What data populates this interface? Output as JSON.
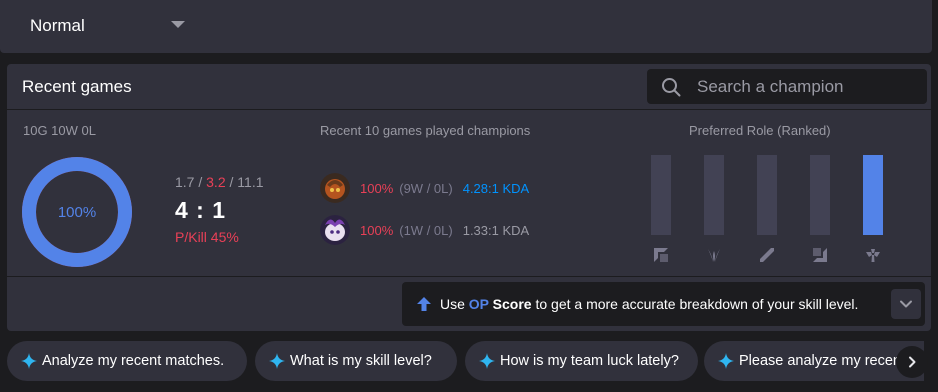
{
  "queue": {
    "selected": "Normal"
  },
  "recent_games": {
    "title": "Recent games",
    "search_placeholder": "Search a champion",
    "record": "10G 10W 0L",
    "win_rate": "100%",
    "win_rate_fraction": 1.0,
    "kda": {
      "kills": "1.7",
      "deaths": "3.2",
      "assists": "11.1",
      "sep": " / "
    },
    "ratio": "4 : 1",
    "pkill": "P/Kill 45%",
    "champions_title": "Recent 10 games played champions",
    "champions": [
      {
        "winrate": "100%",
        "record": "(9W / 0L)",
        "kda": "4.28:1 KDA",
        "kda_color": "#0093ff"
      },
      {
        "winrate": "100%",
        "record": "(1W / 0L)",
        "kda": "1.33:1 KDA",
        "kda_color": "#9a9aa4"
      }
    ],
    "roles_title": "Preferred Role (Ranked)",
    "roles": [
      {
        "icon": "top-role-icon",
        "share": 0.0
      },
      {
        "icon": "jungle-role-icon",
        "share": 0.0
      },
      {
        "icon": "mid-role-icon",
        "share": 0.0
      },
      {
        "icon": "bottom-role-icon",
        "share": 0.0
      },
      {
        "icon": "support-role-icon",
        "share": 1.0
      }
    ],
    "op_banner": {
      "prefix": "Use ",
      "op": "OP",
      "score": " Score",
      "suffix": " to get a more accurate breakdown of your skill level."
    }
  },
  "suggestions": [
    "Analyze my recent matches.",
    "What is my skill level?",
    "How is my team luck lately?",
    "Please analyze my recent"
  ],
  "colors": {
    "accent": "#5383e8",
    "loss_red": "#e84057",
    "panel": "#31313c",
    "bg": "#1c1c1f"
  }
}
